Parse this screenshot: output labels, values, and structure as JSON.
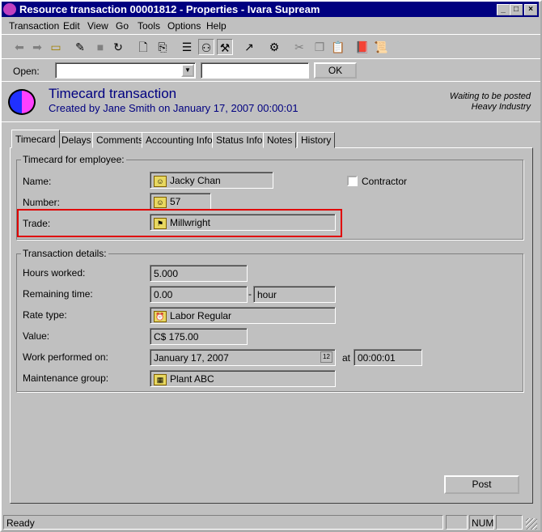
{
  "window": {
    "title": "Resource transaction 00001812 - Properties - Ivara Supream"
  },
  "menu": [
    "Transaction",
    "Edit",
    "View",
    "Go",
    "Tools",
    "Options",
    "Help"
  ],
  "openbar": {
    "label": "Open:",
    "combo_value": "",
    "text_value": "",
    "ok": "OK"
  },
  "header": {
    "title": "Timecard transaction",
    "subtitle": "Created by Jane Smith on January 17, 2007 00:00:01",
    "status": "Waiting to be posted",
    "industry": "Heavy Industry"
  },
  "tabs": [
    "Timecard",
    "Delays",
    "Comments",
    "Accounting Info",
    "Status Info",
    "Notes",
    "History"
  ],
  "employee": {
    "group": "Timecard for employee:",
    "name_label": "Name:",
    "name": "Jacky Chan",
    "number_label": "Number:",
    "number": "57",
    "trade_label": "Trade:",
    "trade": "Millwright",
    "contractor": "Contractor"
  },
  "details": {
    "group": "Transaction details:",
    "hours_label": "Hours worked:",
    "hours": "5.000",
    "remaining_label": "Remaining time:",
    "remaining": "0.00",
    "remaining_unit": "hour",
    "rate_label": "Rate type:",
    "rate": "Labor Regular",
    "value_label": "Value:",
    "value": "C$ 175.00",
    "work_label": "Work performed on:",
    "work_date": "January 17, 2007",
    "at": "at",
    "work_time": "00:00:01",
    "maint_label": "Maintenance group:",
    "maint": "Plant ABC"
  },
  "post": "Post",
  "statusbar": {
    "text": "Ready",
    "num": "NUM"
  },
  "colors": {
    "titlebar": "#000080",
    "header_text": "#000080",
    "highlight": "#e00000"
  }
}
